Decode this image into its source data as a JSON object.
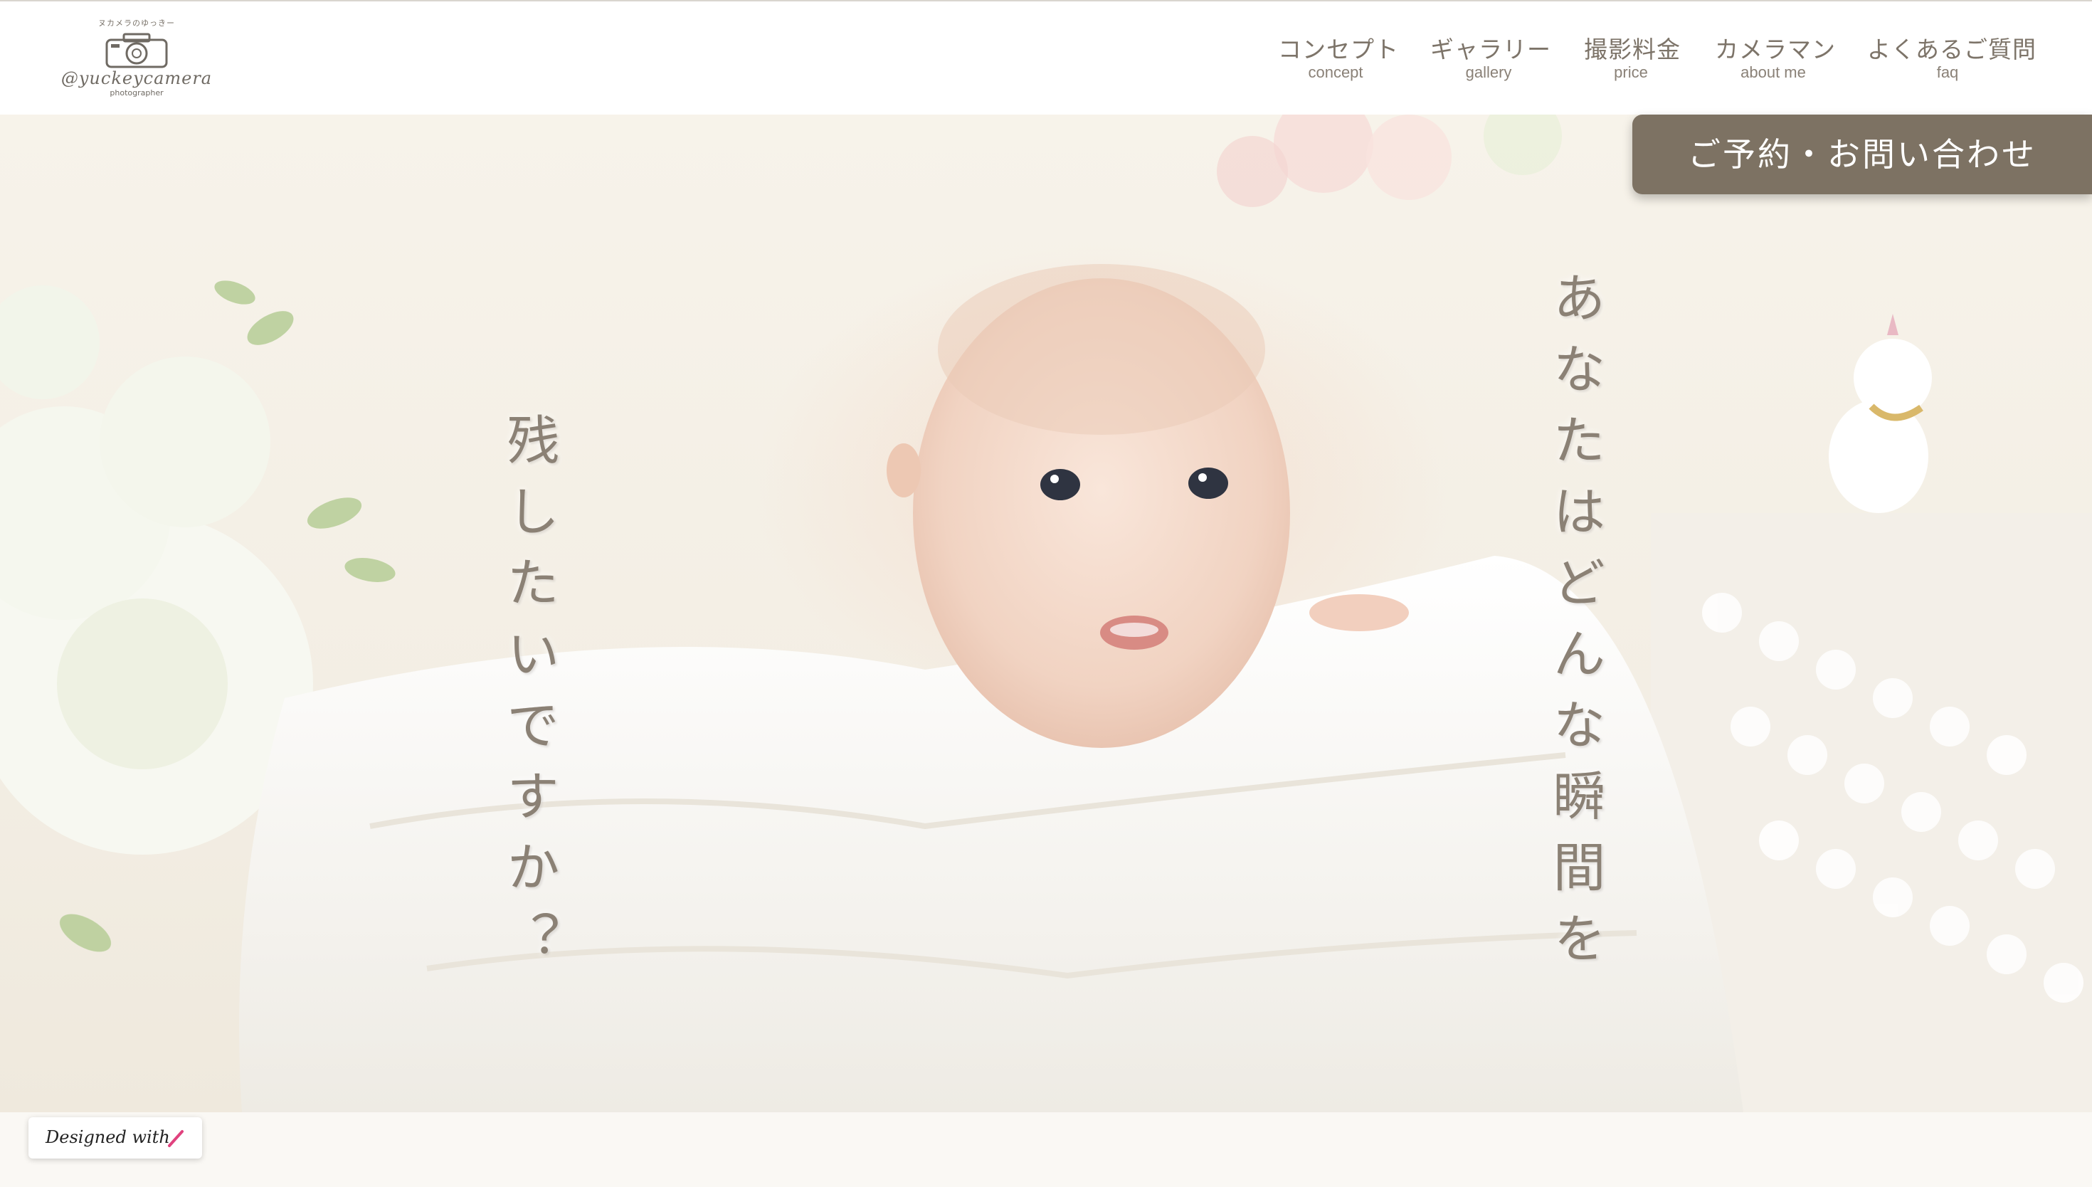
{
  "logo": {
    "tagline": "ヌカメラのゆっきー",
    "script": "@yuckeycamera",
    "subtitle": "photographer"
  },
  "nav": [
    {
      "jp": "コンセプト",
      "en": "concept"
    },
    {
      "jp": "ギャラリー",
      "en": "gallery"
    },
    {
      "jp": "撮影料金",
      "en": "price"
    },
    {
      "jp": "カメラマン",
      "en": "about me"
    },
    {
      "jp": "よくあるご質問",
      "en": "faq"
    }
  ],
  "cta": {
    "label": "ご予約・お問い合わせ"
  },
  "hero": {
    "left_text": "残したいですか？",
    "right_text": "あなたはどんな瞬間を"
  },
  "badge": {
    "label": "Designed with"
  },
  "colors": {
    "accent": "#7d7263",
    "text": "#7d7469"
  }
}
